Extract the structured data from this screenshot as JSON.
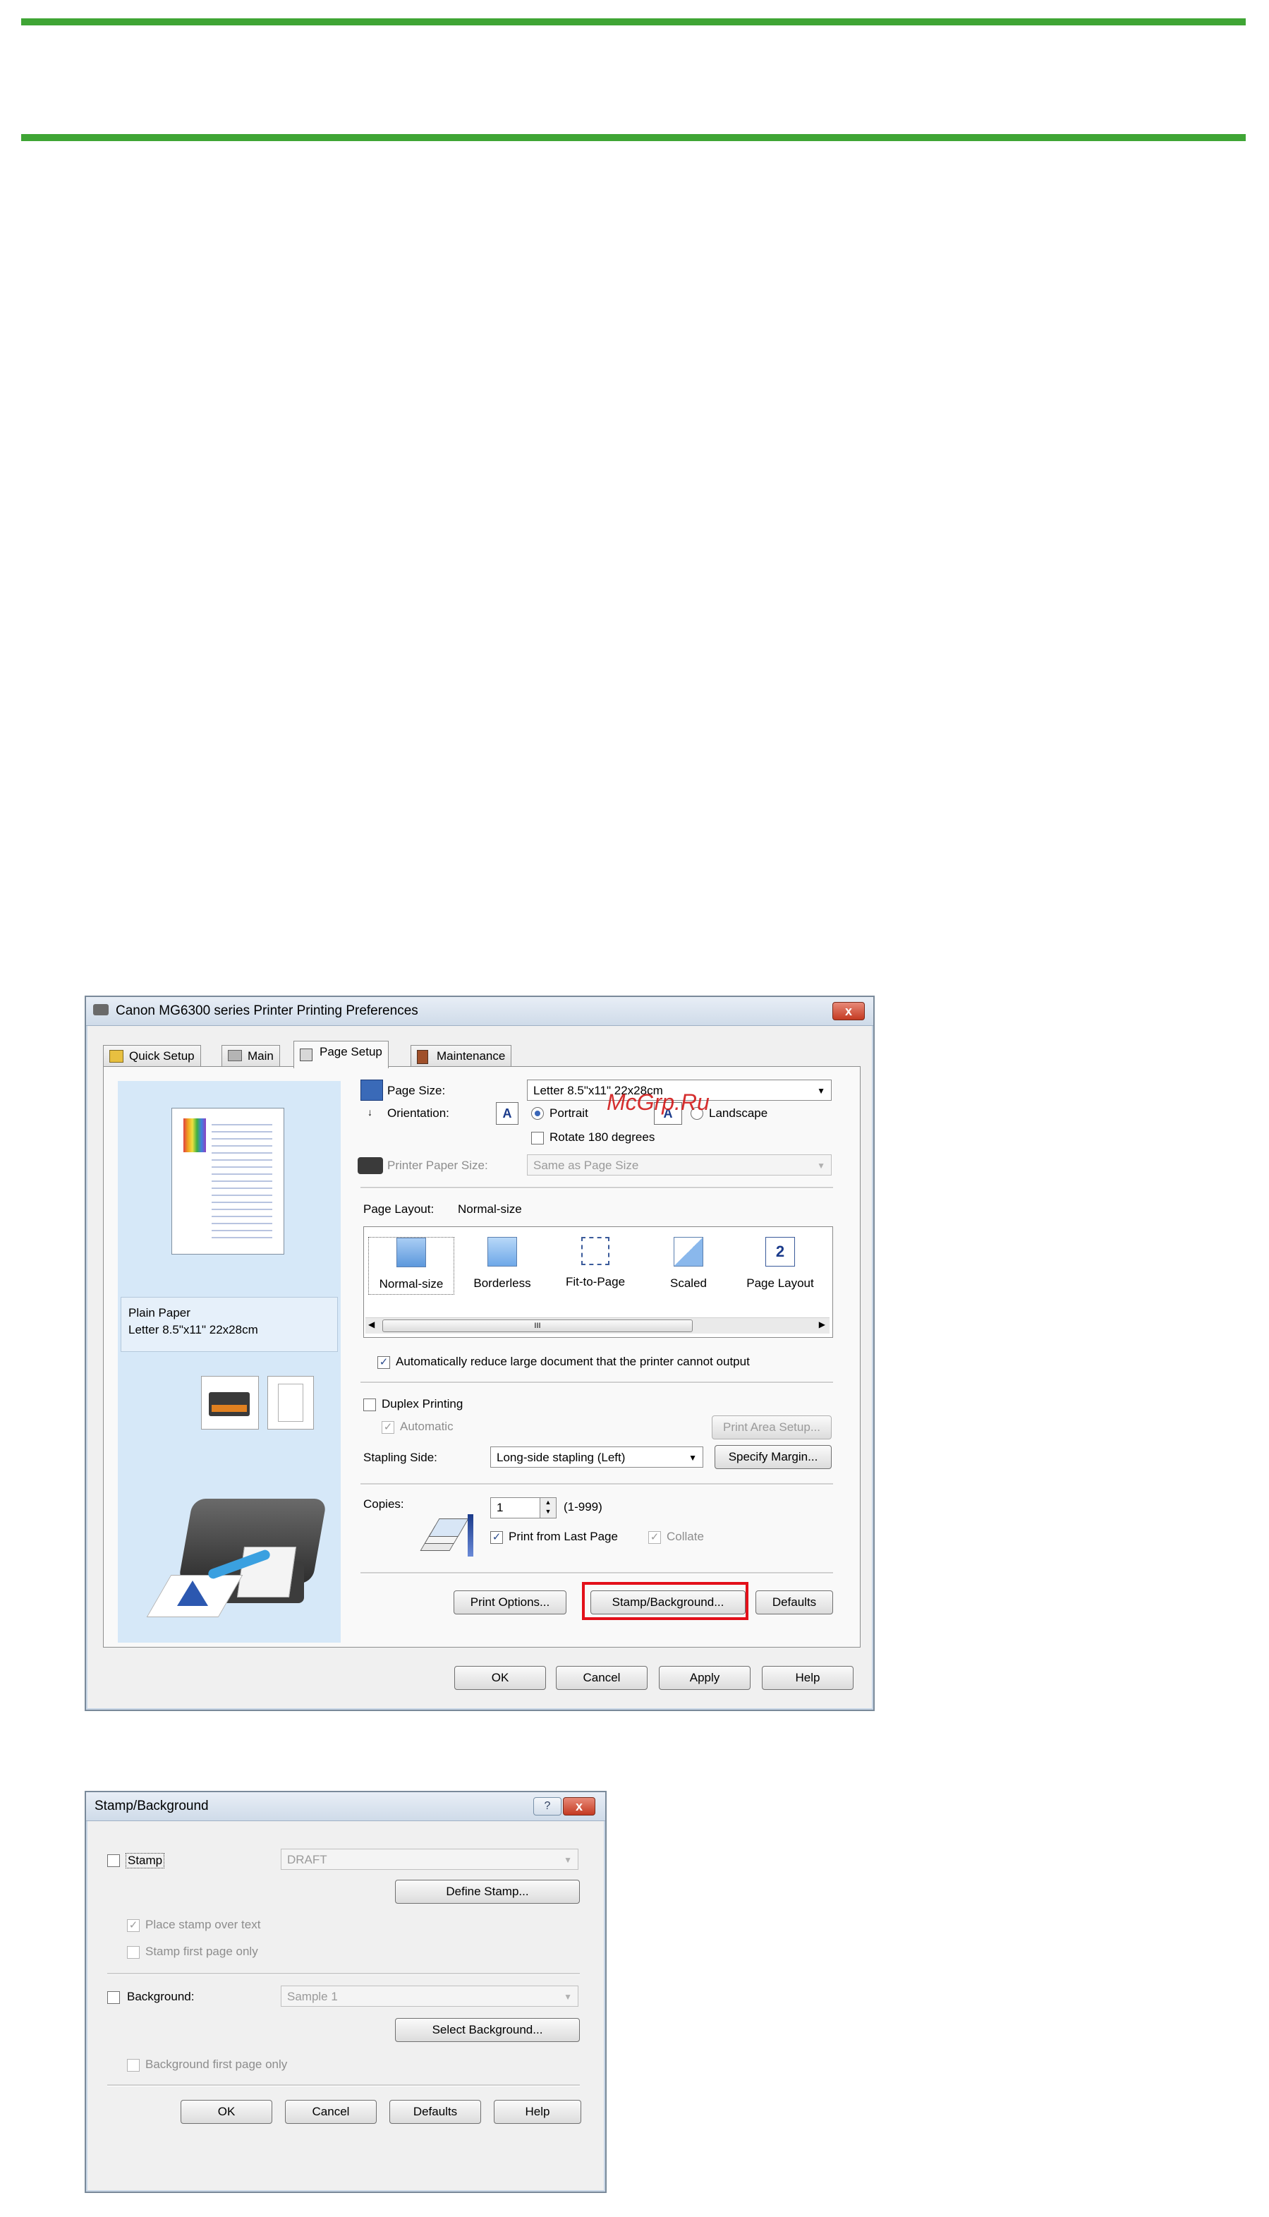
{
  "main_dialog": {
    "title": "Canon MG6300 series Printer Printing Preferences",
    "close": "x",
    "tabs": [
      "Quick Setup",
      "Main",
      "Page Setup",
      "Maintenance"
    ],
    "preview": {
      "media_type": "Plain Paper",
      "page_size": "Letter 8.5\"x11\" 22x28cm"
    },
    "page_size_label": "Page Size:",
    "page_size_value": "Letter 8.5\"x11\" 22x28cm",
    "orientation_label": "Orientation:",
    "portrait": "Portrait",
    "landscape": "Landscape",
    "rotate": "Rotate 180 degrees",
    "printer_paper_size_label": "Printer Paper Size:",
    "printer_paper_size_value": "Same as Page Size",
    "page_layout_label": "Page Layout:",
    "page_layout_value": "Normal-size",
    "layouts": [
      "Normal-size",
      "Borderless",
      "Fit-to-Page",
      "Scaled",
      "Page Layout"
    ],
    "scroll_thumb": "III",
    "auto_reduce": "Automatically reduce large document that the printer cannot output",
    "duplex": "Duplex Printing",
    "automatic": "Automatic",
    "print_area_setup": "Print Area Setup...",
    "stapling_label": "Stapling Side:",
    "stapling_value": "Long-side stapling (Left)",
    "specify_margin": "Specify Margin...",
    "copies_label": "Copies:",
    "copies_value": "1",
    "copies_range": "(1-999)",
    "print_last": "Print from Last Page",
    "collate": "Collate",
    "print_options": "Print Options...",
    "stamp_background": "Stamp/Background...",
    "defaults": "Defaults",
    "ok": "OK",
    "cancel": "Cancel",
    "apply": "Apply",
    "help": "Help"
  },
  "watermark": "McGrp.Ru",
  "stamp_dialog": {
    "title": "Stamp/Background",
    "help_q": "?",
    "close": "x",
    "stamp": "Stamp",
    "stamp_value": "DRAFT",
    "define_stamp": "Define Stamp...",
    "place_over_text": "Place stamp over text",
    "stamp_first_page": "Stamp first page only",
    "background": "Background:",
    "background_value": "Sample 1",
    "select_background": "Select Background...",
    "background_first_page": "Background first page only",
    "ok": "OK",
    "cancel": "Cancel",
    "defaults": "Defaults",
    "help": "Help"
  },
  "colors": {
    "rule": "#3fa535",
    "highlight": "#e3101a",
    "watermark": "#d21d1d"
  }
}
